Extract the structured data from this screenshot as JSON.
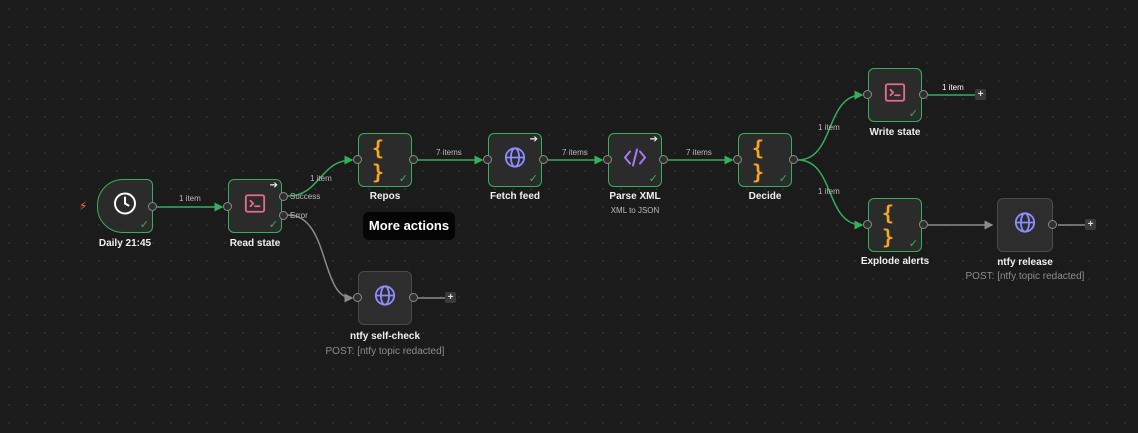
{
  "canvas": {
    "tooltip": "More actions",
    "trigger_bolt": "⚡"
  },
  "nodes": {
    "daily": {
      "label": "Daily 21:45",
      "icon": "clock-icon"
    },
    "read_state": {
      "label": "Read state",
      "icon": "terminal-icon",
      "outputs": [
        "Success",
        "Error"
      ]
    },
    "repos": {
      "label": "Repos",
      "icon": "code-braces-icon"
    },
    "fetch_feed": {
      "label": "Fetch feed",
      "icon": "globe-icon"
    },
    "parse_xml": {
      "label": "Parse XML",
      "sublabel": "XML to JSON",
      "icon": "code-brackets-icon"
    },
    "decide": {
      "label": "Decide",
      "icon": "code-braces-icon"
    },
    "write_state": {
      "label": "Write state",
      "icon": "terminal-icon"
    },
    "explode_alerts": {
      "label": "Explode alerts",
      "icon": "code-braces-icon"
    },
    "ntfy_release": {
      "label": "ntfy release",
      "sublabel": "POST: [ntfy topic redacted]",
      "icon": "globe-icon"
    },
    "ntfy_selfcheck": {
      "label": "ntfy self-check",
      "sublabel": "POST: [ntfy topic redacted]",
      "icon": "globe-icon"
    }
  },
  "edges": {
    "daily_read": "1 item",
    "read_repos": "1 item",
    "repos_fetch": "7 items",
    "fetch_parse": "7 items",
    "parse_decide": "7 items",
    "decide_write": "1 item",
    "decide_explode": "1 item",
    "write_out": "1 item"
  },
  "colors": {
    "success": "#35b05a",
    "idle": "#8a8a8a",
    "braces": "#f5a623",
    "terminal": "#e66b8a",
    "globe": "#8c8cff",
    "code": "#a77bf3"
  }
}
